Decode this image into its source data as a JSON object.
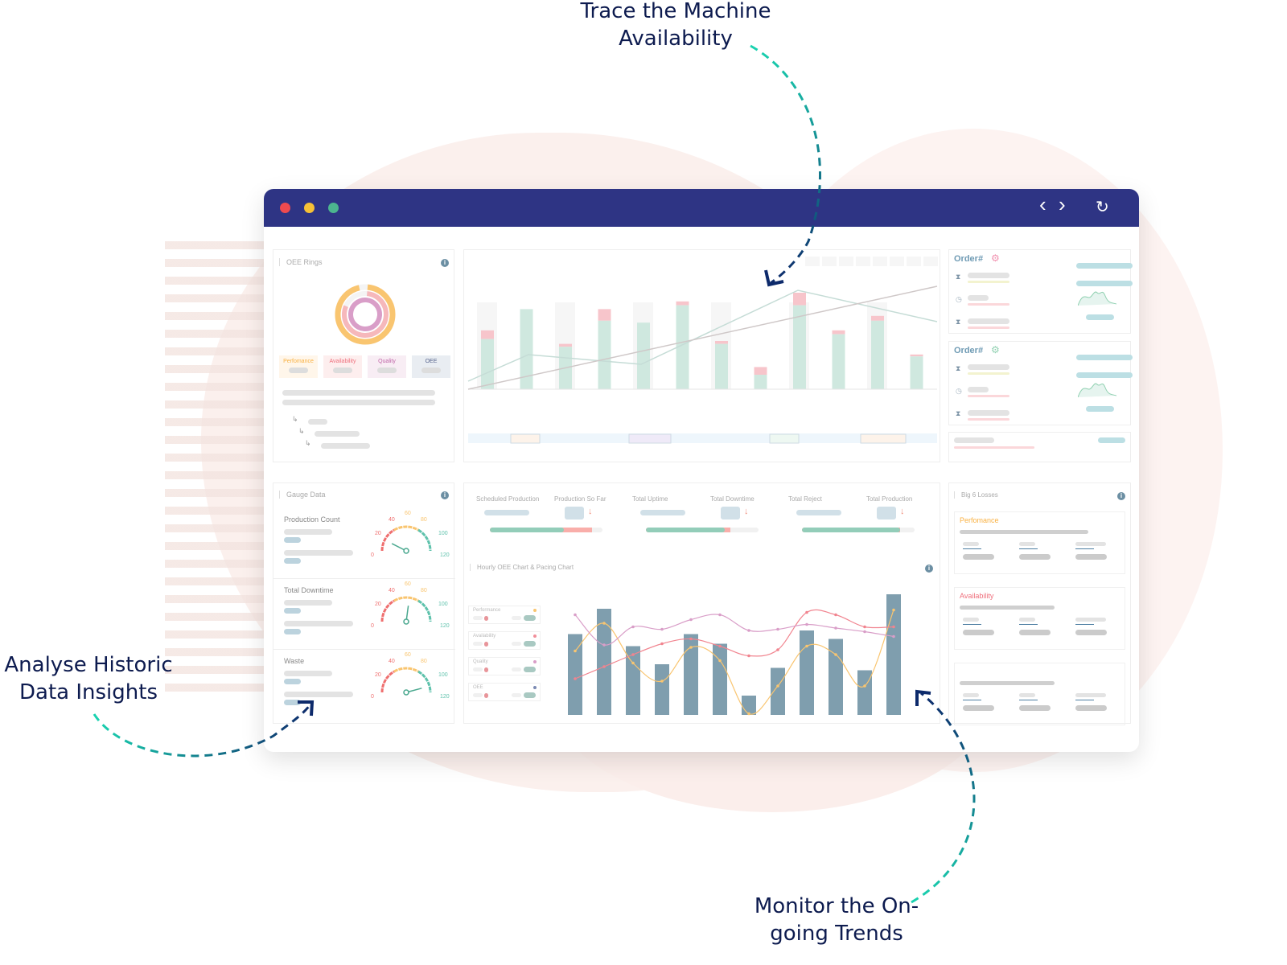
{
  "colors": {
    "nav": "#2e3484",
    "annotation": "#0d1b4f",
    "teal": "#1ad3b0",
    "navy": "#0d2a6b",
    "green_bar": "#cfe8df",
    "red_bar": "#f7c5cb",
    "slate_bar": "#7f9eae",
    "performance": "#f9c570",
    "availability": "#f18f9a",
    "quality": "#d99ec8",
    "oee": "#7b8ab3"
  },
  "annotations": {
    "top": "Trace the Machine Availability",
    "left": "Analyse Historic Data Insights",
    "bottom": "Monitor the On-going Trends"
  },
  "window": {
    "controls": [
      "close",
      "minimize",
      "maximize"
    ],
    "nav_back_icon": "‹",
    "nav_forward_icon": "›",
    "refresh_icon": "↻"
  },
  "oee_rings": {
    "title": "OEE Rings",
    "rings": [
      {
        "name": "Performance",
        "value": 0.95
      },
      {
        "name": "Availability",
        "value": 0.8
      },
      {
        "name": "Quality",
        "value": 1.0
      }
    ],
    "tiles": [
      "Perfomance",
      "Availability",
      "Quality",
      "OEE"
    ]
  },
  "top_chart": {
    "chart_data": {
      "type": "bar",
      "stacked": true,
      "series": [
        {
          "name": "",
          "values": [
            52,
            83,
            44,
            71,
            69,
            87,
            47,
            15,
            87,
            57,
            71,
            34
          ]
        },
        {
          "name": "",
          "values": [
            9,
            0,
            3,
            12,
            0,
            4,
            3,
            8,
            13,
            4,
            5,
            2
          ]
        }
      ],
      "lines": [
        [
          10,
          35,
          28,
          25,
          50,
          73,
          58,
          48
        ],
        [
          0,
          100
        ]
      ]
    }
  },
  "orders": [
    {
      "label": "Order#",
      "status_color": "#f18fae"
    },
    {
      "label": "Order#",
      "status_color": "#8fd0b0"
    }
  ],
  "kpis": {
    "labels": [
      "Scheduled Production",
      "Production So Far",
      "Total Uptime",
      "Total Downtime",
      "Total Reject",
      "Total Production"
    ],
    "progress": [
      {
        "good": 0.66,
        "bad": 0.25
      },
      {
        "good": 0.7,
        "bad": 0.05
      },
      {
        "good": 0.87,
        "bad": 0
      }
    ]
  },
  "gauges": {
    "title": "Gauge Data",
    "ticks": [
      "0",
      "20",
      "40",
      "60",
      "80",
      "100",
      "120"
    ],
    "items": [
      {
        "label": "Production Count",
        "value": 18
      },
      {
        "label": "Total Downtime",
        "value": 65
      },
      {
        "label": "Waste",
        "value": 110
      }
    ]
  },
  "hourly": {
    "title": "Hourly OEE Chart & Pacing Chart",
    "legend": [
      "Performance",
      "Availability",
      "Quality",
      "OEE"
    ],
    "chart_data": {
      "type": "bar",
      "bars": [
        67,
        88,
        57,
        42,
        67,
        59,
        16,
        39,
        70,
        63,
        37,
        100
      ],
      "series": [
        {
          "name": "Performance",
          "values": [
            53,
            76,
            43,
            28,
            56,
            45,
            1,
            24,
            57,
            50,
            24,
            87
          ]
        },
        {
          "name": "Availability",
          "values": [
            30,
            40,
            50,
            59,
            63,
            57,
            49,
            54,
            85,
            83,
            73,
            73
          ]
        },
        {
          "name": "Quality",
          "values": [
            83,
            58,
            73,
            71,
            79,
            83,
            70,
            71,
            75,
            72,
            69,
            65
          ]
        }
      ]
    }
  },
  "big6": {
    "title": "Big 6 Losses",
    "sections": [
      {
        "label": "Perfomance",
        "color": "#f9b040"
      },
      {
        "label": "Availability",
        "color": "#ef6f7c"
      },
      {
        "label": "",
        "color": ""
      }
    ]
  }
}
